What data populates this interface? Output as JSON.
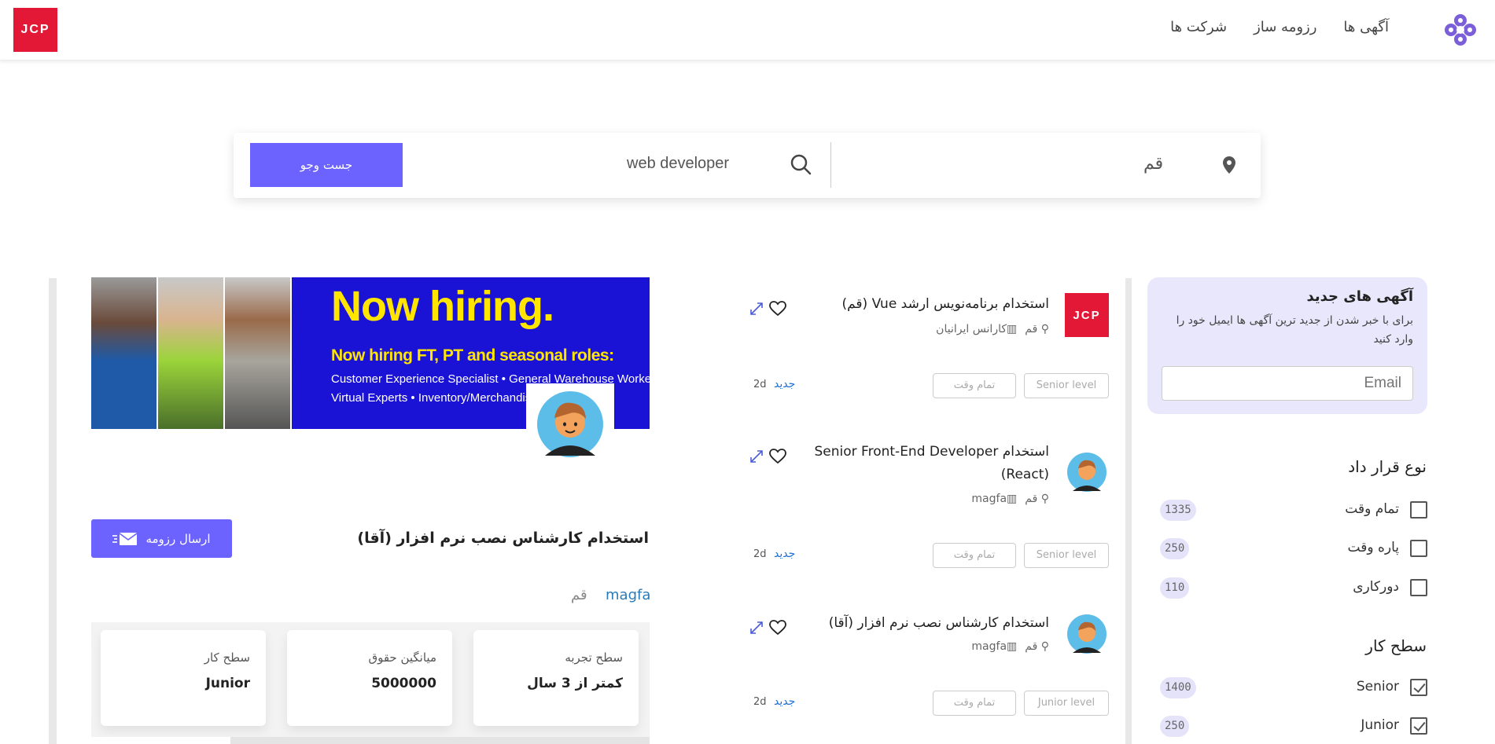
{
  "header": {
    "brand": "JCP",
    "nav": [
      "آگهی ها",
      "رزومه ساز",
      "شرکت ها"
    ]
  },
  "search": {
    "button": "جست وجو",
    "keyword": "web developer",
    "city": "قم"
  },
  "newsletter": {
    "title": "آگهی های جدید",
    "text": "برای با خبر شدن از جدید ترین آگهی ها ایمیل خود را وارد کنید",
    "placeholder": "Email"
  },
  "filters": {
    "contract_title": "نوع قرار داد",
    "contract": [
      {
        "label": "تمام وقت",
        "count": "1335",
        "checked": false
      },
      {
        "label": "پاره وقت",
        "count": "250",
        "checked": false
      },
      {
        "label": "دورکاری",
        "count": "110",
        "checked": false
      }
    ],
    "level_title": "سطح کار",
    "level": [
      {
        "label": "Senior",
        "count": "1400",
        "checked": true
      },
      {
        "label": "Junior",
        "count": "250",
        "checked": true
      }
    ]
  },
  "jobs": [
    {
      "title": "استخدام برنامه‌نویس ارشد Vue (قم)",
      "city": "قم",
      "company": "کارانس ایرانیان",
      "level": "Senior level",
      "type": "تمام وقت",
      "badge": "جدید",
      "age": "2d",
      "logo": "jcp"
    },
    {
      "title": "استخدام Senior Front-End Developer (React)",
      "city": "قم",
      "company": "magfa",
      "level": "Senior level",
      "type": "تمام وقت",
      "badge": "جدید",
      "age": "2d",
      "logo": "avatar"
    },
    {
      "title": "استخدام کارشناس نصب نرم افزار (آقا)",
      "city": "قم",
      "company": "magfa",
      "level": "Junior level",
      "type": "تمام وقت",
      "badge": "جدید",
      "age": "2d",
      "logo": "avatar"
    }
  ],
  "detail": {
    "banner_headline": "Now hiring.",
    "banner_sub": "Now hiring FT, PT and seasonal roles:",
    "banner_line1": "Customer Experience Specialist  •  General Warehouse Worker",
    "banner_line2": "Virtual Experts  •  Inventory/Merchandising Specialist",
    "title": "استخدام کارشناس نصب نرم افزار (آقا)",
    "send_button": "ارسال رزومه",
    "company": "magfa",
    "city": "قم",
    "info": [
      {
        "key": "سطح تجربه",
        "value": "کمتر از 3 سال"
      },
      {
        "key": "میانگین حقوق",
        "value": "5000000"
      },
      {
        "key": "سطح کار",
        "value": "Junior"
      }
    ]
  },
  "colors": {
    "accent": "#6c63ff",
    "brand_red": "#e31837",
    "banner_blue": "#1a13d6",
    "banner_yellow": "#ffe500",
    "link_blue": "#1d6fd6"
  }
}
